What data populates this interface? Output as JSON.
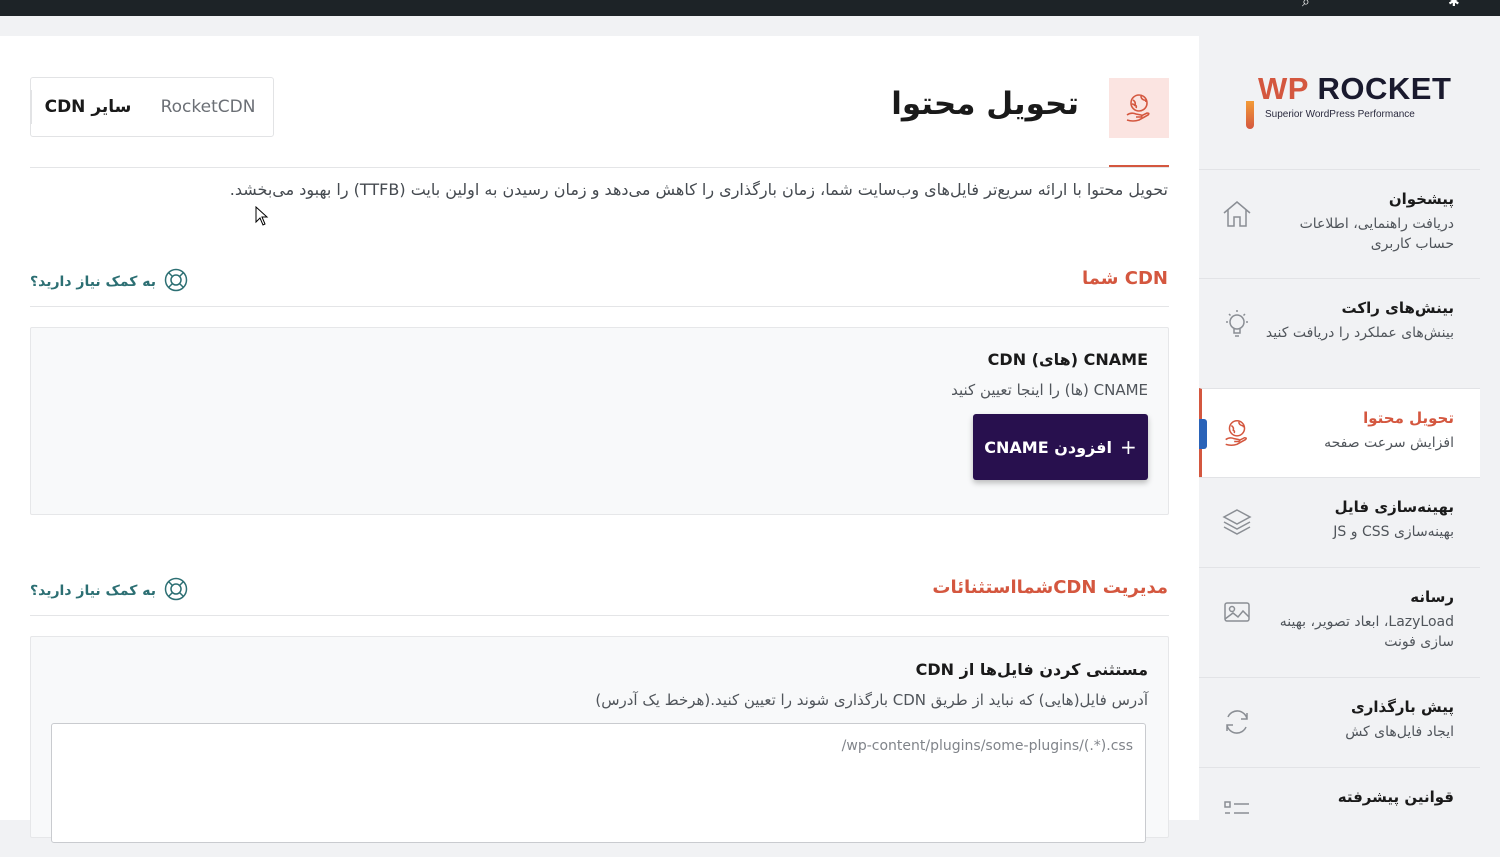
{
  "page": {
    "title": "تحویل محتوا",
    "description": "تحویل محتوا با ارائه سریع‌تر فایل‌های وب‌سایت شما، زمان بارگذاری را کاهش می‌دهد و زمان رسیدن به اولین بایت (TTFB) را بهبود می‌بخشد.",
    "tabs": [
      {
        "label": "RocketCDN"
      },
      {
        "label": "سایر CDN"
      }
    ]
  },
  "sections": {
    "cdn": {
      "title": "CDN شما",
      "help": "به کمک نیاز دارید؟",
      "field_label": "CNAME (های) CDN",
      "field_desc": "CNAME (ها) را اینجا تعیین کنید",
      "button_label": "افزودن CNAME",
      "button_icon": "+"
    },
    "exclusions": {
      "title": "مدیریت CDNشمااستثنائات",
      "help": "به کمک نیاز دارید؟",
      "field_label": "مستثنی کردن فایل‌ها از CDN",
      "field_desc": "آدرس فایل(هایی) که نباید از طریق CDN بارگذاری شوند را تعیین کنید.(هرخط یک آدرس)",
      "placeholder": "/wp-content/plugins/some-plugins/(.*).css"
    }
  },
  "sidebar": {
    "logo": {
      "brand_prefix": "WP",
      "brand_name": " ROCKET",
      "tagline": "Superior WordPress Performance"
    },
    "items": [
      {
        "title": "پیشخوان",
        "subtitle": "دریافت راهنمایی، اطلاعات حساب کاربری",
        "icon": "home-icon"
      },
      {
        "title": "بینش‌های راکت",
        "subtitle": "بینش‌های عملکرد را دریافت کنید",
        "icon": "lightbulb-icon"
      },
      {
        "title": "تحویل محتوا",
        "subtitle": "افزایش سرعت صفحه",
        "icon": "globe-hand-icon",
        "active": true
      },
      {
        "title": "بهینه‌سازی فایل",
        "subtitle": "بهینه‌سازی CSS و JS",
        "icon": "layers-icon"
      },
      {
        "title": "رسانه",
        "subtitle": "LazyLoad، ابعاد تصویر، بهینه سازی فونت",
        "icon": "image-icon"
      },
      {
        "title": "پیش بارگذاری",
        "subtitle": "ایجاد فایل‌های کش",
        "icon": "refresh-icon"
      },
      {
        "title": "قوانین پیشرفته",
        "subtitle": "",
        "icon": "list-icon"
      }
    ]
  },
  "colors": {
    "accent": "#d4573f",
    "button": "#28104e",
    "help": "#2c6f73"
  }
}
